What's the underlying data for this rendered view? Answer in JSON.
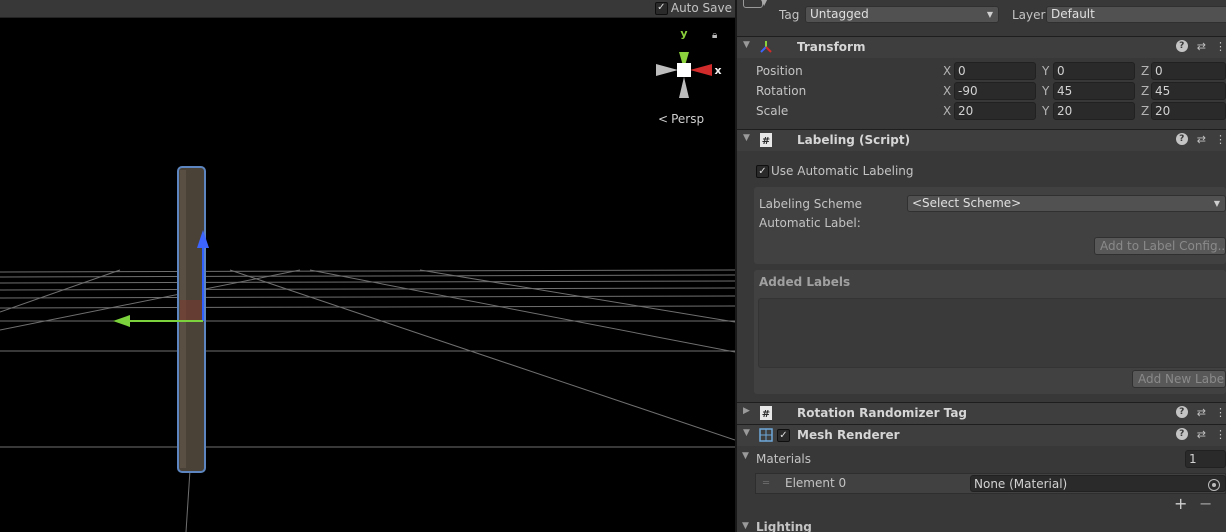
{
  "scene": {
    "autosave_label": "Auto Save",
    "autosave_checked": true,
    "gizmo": {
      "y": "y",
      "x": "x"
    },
    "persp_label": "Persp"
  },
  "inspector": {
    "tag_label": "Tag",
    "tag_value": "Untagged",
    "layer_label": "Layer",
    "layer_value": "Default",
    "transform": {
      "title": "Transform",
      "rows": [
        {
          "label": "Position",
          "x": "0",
          "y": "0",
          "z": "0"
        },
        {
          "label": "Rotation",
          "x": "-90",
          "y": "45",
          "z": "45"
        },
        {
          "label": "Scale",
          "x": "20",
          "y": "20",
          "z": "20"
        }
      ],
      "axis_labels": {
        "x": "X",
        "y": "Y",
        "z": "Z"
      }
    },
    "labeling": {
      "title": "Labeling (Script)",
      "use_auto_label": "Use Automatic Labeling",
      "use_auto_checked": true,
      "scheme_label": "Labeling Scheme",
      "scheme_value": "<Select Scheme>",
      "auto_label": "Automatic Label:",
      "add_to_config": "Add to Label Config...",
      "added_labels": "Added Labels",
      "add_new_label": "Add New Label"
    },
    "rotation_randomizer": {
      "title": "Rotation Randomizer Tag"
    },
    "mesh_renderer": {
      "title": "Mesh Renderer",
      "materials_label": "Materials",
      "materials_count": "1",
      "element_label": "Element 0",
      "element_value": "None (Material)",
      "lighting_label": "Lighting"
    }
  }
}
